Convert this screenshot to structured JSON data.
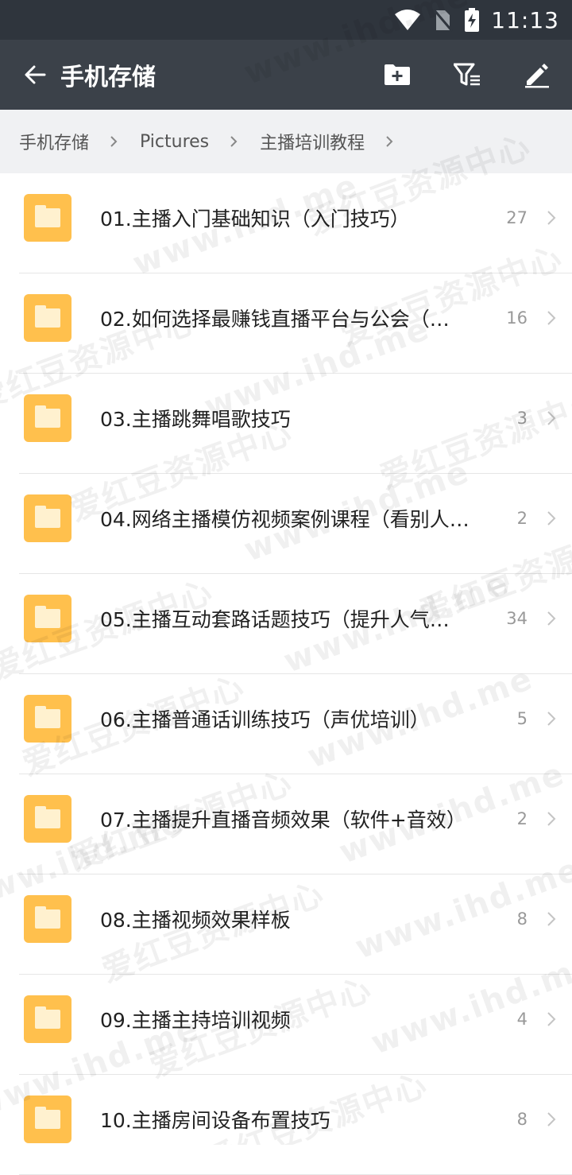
{
  "status_bar": {
    "time": "11:13",
    "icons": [
      "wifi-icon",
      "no-sim-icon",
      "battery-charging-icon"
    ]
  },
  "app_bar": {
    "back_icon": "arrow-left-icon",
    "title": "手机存储",
    "actions": [
      "new-folder-icon",
      "filter-icon",
      "edit-icon"
    ]
  },
  "breadcrumb": {
    "items": [
      "手机存储",
      "Pictures",
      "主播培训教程"
    ]
  },
  "folders": [
    {
      "name": "01.主播入门基础知识（入门技巧）",
      "count": "27"
    },
    {
      "name": "02.如何选择最赚钱直播平台与公会（…",
      "count": "16"
    },
    {
      "name": "03.主播跳舞唱歌技巧",
      "count": "3"
    },
    {
      "name": "04.网络主播模仿视频案例课程（看别人…",
      "count": "2"
    },
    {
      "name": "05.主播互动套路话题技巧（提升人气…",
      "count": "34"
    },
    {
      "name": "06.主播普通话训练技巧（声优培训）",
      "count": "5"
    },
    {
      "name": "07.主播提升直播音频效果（软件+音效）",
      "count": "2"
    },
    {
      "name": "08.主播视频效果样板",
      "count": "8"
    },
    {
      "name": "09.主播主持培训视频",
      "count": "4"
    },
    {
      "name": "10.主播房间设备布置技巧",
      "count": "8"
    }
  ],
  "watermark": [
    "爱红豆资源中心",
    "www.ihd.me"
  ],
  "colors": {
    "status_bar": "#2f353d",
    "app_bar": "#3b4149",
    "breadcrumb_bg": "#f0f1f3",
    "folder": "#ffc04d"
  }
}
